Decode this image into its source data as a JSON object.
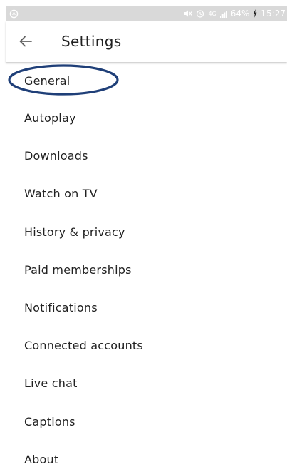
{
  "status_bar": {
    "battery": "64%",
    "time": "15:27",
    "network": "4G",
    "background_color": "#d9d9d9",
    "icons": [
      "app-notification-icon",
      "mute-icon",
      "alarm-icon",
      "network-icon",
      "signal-icon",
      "battery-charging-icon"
    ]
  },
  "app_bar": {
    "title": "Settings",
    "back_icon": "arrow-left-icon"
  },
  "menu": {
    "items": [
      {
        "label": "General"
      },
      {
        "label": "Autoplay"
      },
      {
        "label": "Downloads"
      },
      {
        "label": "Watch on TV"
      },
      {
        "label": "History & privacy"
      },
      {
        "label": "Paid memberships"
      },
      {
        "label": "Notifications"
      },
      {
        "label": "Connected accounts"
      },
      {
        "label": "Live chat"
      },
      {
        "label": "Captions"
      },
      {
        "label": "About"
      }
    ]
  },
  "annotation": {
    "highlighted_item": "General",
    "color": "#1f3f78"
  }
}
